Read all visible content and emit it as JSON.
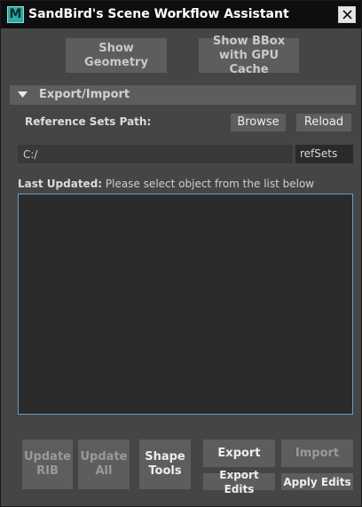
{
  "window": {
    "title": "SandBird's Scene Workflow Assistant",
    "icon_letter": "M"
  },
  "top_buttons": {
    "show_geometry": "Show\nGeometry",
    "show_bbox": "Show BBox\nwith GPU Cache"
  },
  "section": {
    "title": "Export/Import"
  },
  "reference": {
    "label": "Reference Sets Path:",
    "browse": "Browse",
    "reload": "Reload",
    "path_value": "C:/",
    "refsets_value": "refSets"
  },
  "last_updated": {
    "label": "Last Updated:",
    "message": "Please select object from the list below"
  },
  "bottom_buttons": {
    "update_rib": "Update\nRIB",
    "update_all": "Update\nAll",
    "shape_tools": "Shape\nTools",
    "export": "Export",
    "import": "Import",
    "export_edits": "Export Edits",
    "apply_edits": "Apply Edits"
  },
  "colors": {
    "titlebar": "#0e0e0e",
    "panel": "#454545",
    "button": "#5d5d5d",
    "list_border": "#6b9ac1"
  }
}
